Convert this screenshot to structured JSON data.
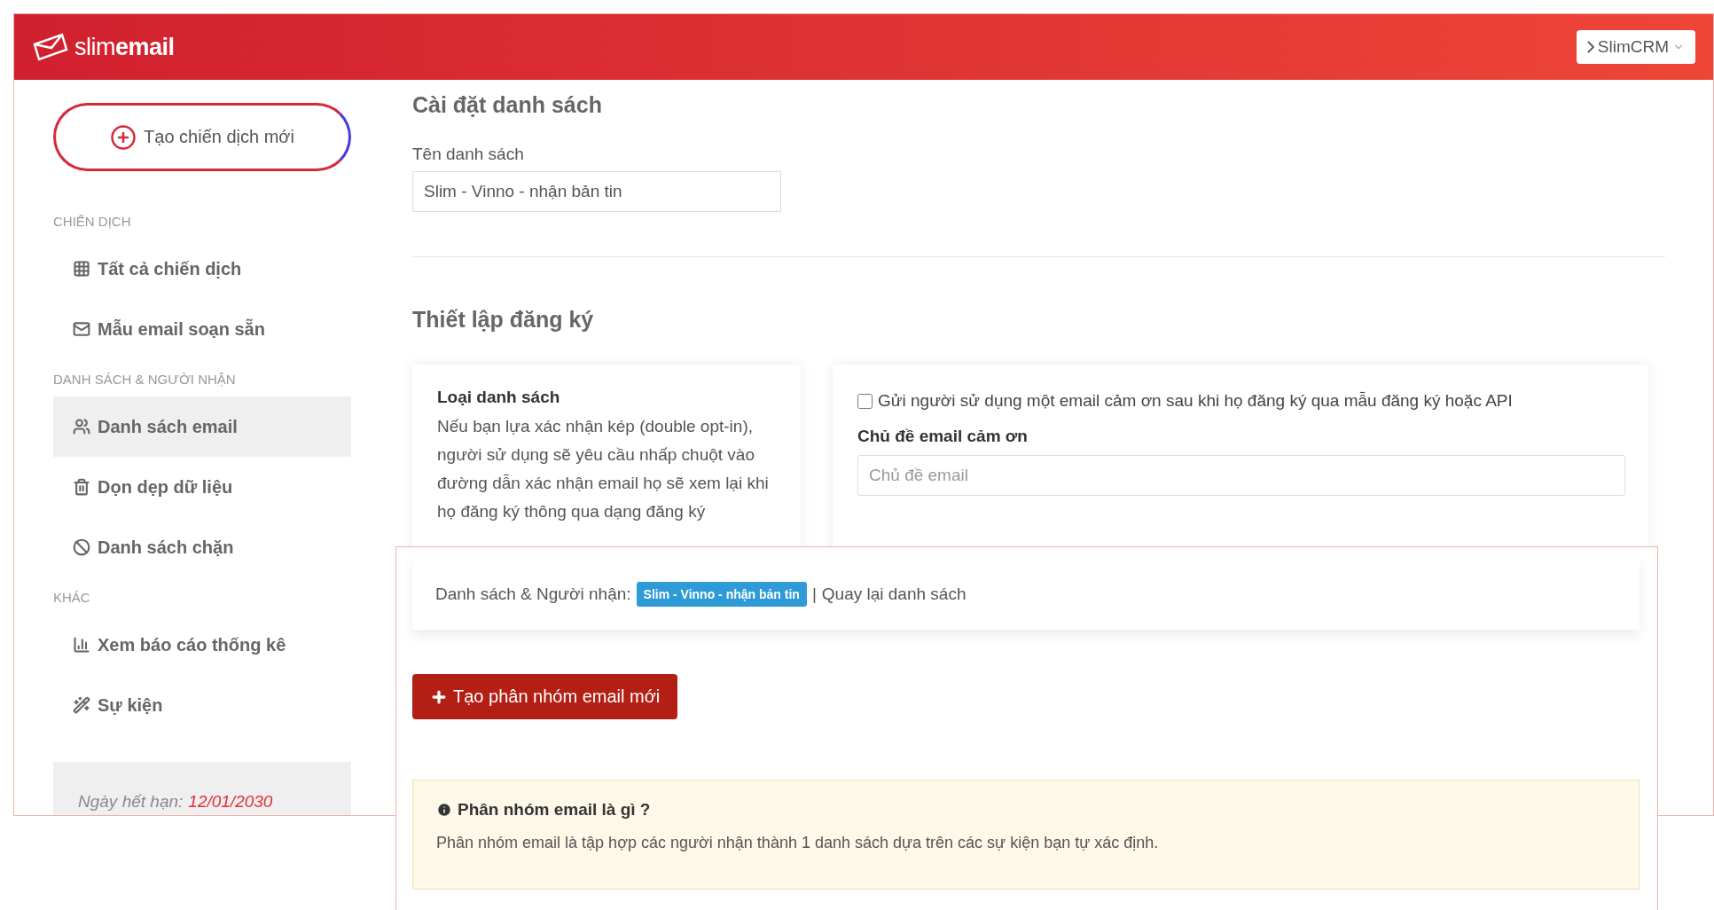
{
  "header": {
    "logo_light": "slim",
    "logo_bold": "email",
    "switcher": "SlimCRM"
  },
  "sidebar": {
    "new_campaign": "Tạo chiến dịch mới",
    "sections": [
      {
        "title": "CHIẾN DỊCH",
        "items": [
          {
            "kind": "campaigns",
            "label": "Tất cả chiến dịch",
            "selected": false
          },
          {
            "kind": "templates",
            "label": "Mẫu email soạn sẵn",
            "selected": false
          }
        ]
      },
      {
        "title": "DANH SÁCH & NGƯỜI NHẬN",
        "items": [
          {
            "kind": "lists",
            "label": "Danh sách email",
            "selected": true
          },
          {
            "kind": "cleanup",
            "label": "Dọn dẹp dữ liệu",
            "selected": false
          },
          {
            "kind": "blocklist",
            "label": "Danh sách chặn",
            "selected": false
          }
        ]
      },
      {
        "title": "KHÁC",
        "items": [
          {
            "kind": "reports",
            "label": "Xem báo cáo thống kê",
            "selected": false
          },
          {
            "kind": "events",
            "label": "Sự kiện",
            "selected": false
          }
        ]
      }
    ],
    "expiry_label": "Ngày hết hạn:",
    "expiry_date": "12/01/2030"
  },
  "settings": {
    "title": "Cài đặt danh sách",
    "name_label": "Tên danh sách",
    "name_value": "Slim - Vinno - nhận bản tin"
  },
  "signup": {
    "title": "Thiết lập đăng ký",
    "type_title": "Loại danh sách",
    "type_text": "Nếu bạn lựa xác nhận kép (double opt-in), người sử dụng sẽ yêu cầu nhấp chuột vào đường dẫn xác nhận email họ sẽ xem lại khi họ đăng ký thông qua dạng đăng ký",
    "thanks_checkbox": {
      "label": "Gửi người sử dụng một email cảm ơn sau khi họ đăng ký qua mẫu đăng ký hoặc API",
      "checked": false
    },
    "subject_label": "Chủ đề email cảm ơn",
    "subject_placeholder": "Chủ đề email"
  },
  "overlay": {
    "breadcrumb_label": "Danh sách & Người nhận:",
    "list_badge": "Slim - Vinno - nhận bản tin",
    "separator": "|",
    "back_link": "Quay lại danh sách",
    "new_segment": "Tạo phân nhóm email mới",
    "info_title": "Phân nhóm email là gì ?",
    "info_text": "Phân nhóm email là tập hợp các người nhận thành 1 danh sách dựa trên các sự kiện bạn tự xác định."
  }
}
